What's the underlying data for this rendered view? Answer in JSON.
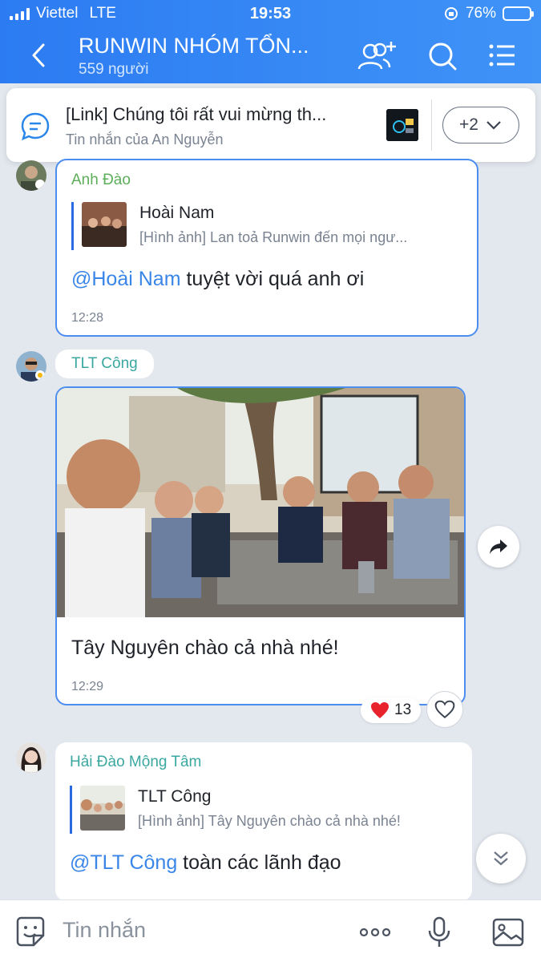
{
  "status_bar": {
    "carrier": "Viettel",
    "network": "LTE",
    "time": "19:53",
    "battery": "76%",
    "battery_level": 0.76
  },
  "header": {
    "title": "RUNWIN NHÓM TỔN...",
    "subtitle": "559 người"
  },
  "pinned": {
    "title": "[Link] Chúng tôi rất vui mừng th...",
    "subtitle": "Tin nhắn của An Nguyễn",
    "more_count": "+2"
  },
  "messages": [
    {
      "sender": "Anh Đào",
      "quote_name": "Hoài Nam",
      "quote_text": "[Hình ảnh] Lan toả Runwin đến mọi ngư...",
      "mention": "@Hoài Nam",
      "text": " tuyệt vời quá anh ơi",
      "time": "12:28"
    },
    {
      "sender": "TLT Công",
      "caption": "Tây Nguyên chào cả nhà nhé!",
      "time": "12:29",
      "reaction_count": "13"
    },
    {
      "sender": "Hải Đào Mộng Tâm",
      "quote_name": "TLT Công",
      "quote_text": "[Hình ảnh] Tây Nguyên chào cả nhà nhé!",
      "mention": "@TLT Công",
      "text": " toàn các lãnh đạo"
    }
  ],
  "input": {
    "placeholder": "Tin nhắn"
  },
  "colors": {
    "header": "#2c7bf2",
    "mention": "#3a86e8",
    "sender_green": "#3aa7a0",
    "selected_border": "#4c8df0"
  }
}
